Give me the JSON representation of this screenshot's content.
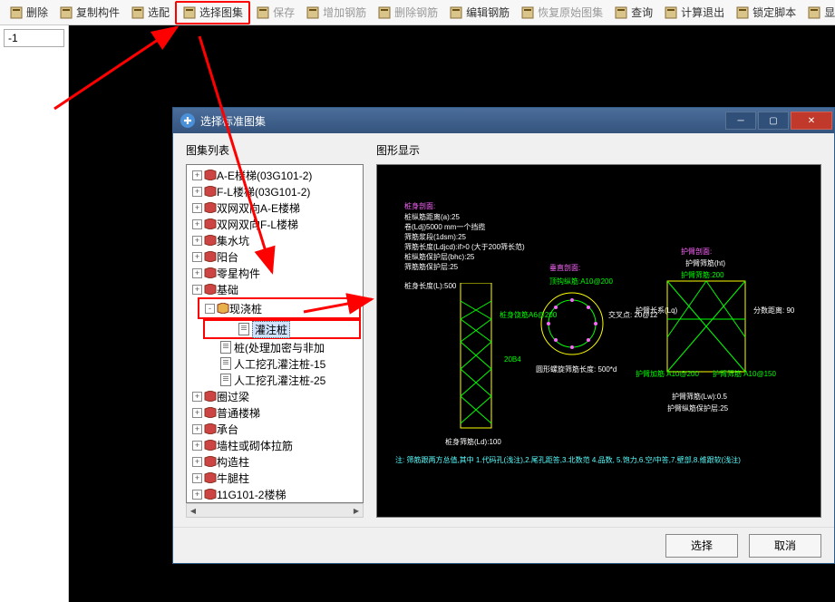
{
  "toolbar": [
    {
      "id": "delete",
      "label": "删除",
      "disabled": false
    },
    {
      "id": "copy-component",
      "label": "复制构件",
      "disabled": false
    },
    {
      "id": "select-config",
      "label": "选配",
      "disabled": false
    },
    {
      "id": "select-drawing-set",
      "label": "选择图集",
      "disabled": false,
      "highlight": true
    },
    {
      "id": "save",
      "label": "保存",
      "disabled": true
    },
    {
      "id": "add-rebar",
      "label": "增加钢筋",
      "disabled": true
    },
    {
      "id": "delete-rebar",
      "label": "删除钢筋",
      "disabled": true
    },
    {
      "id": "edit-rebar",
      "label": "编辑钢筋",
      "disabled": false
    },
    {
      "id": "restore-drawing",
      "label": "恢复原始图集",
      "disabled": true
    },
    {
      "id": "query",
      "label": "查询",
      "disabled": false
    },
    {
      "id": "calc-exit",
      "label": "计算退出",
      "disabled": false
    },
    {
      "id": "lock-script",
      "label": "锁定脚本",
      "disabled": false
    },
    {
      "id": "show-full",
      "label": "显示全图",
      "disabled": false
    }
  ],
  "left_panel": {
    "value": "-1"
  },
  "dialog": {
    "title": "选择标准图集",
    "tree_label": "图集列表",
    "preview_label": "图形显示",
    "select_btn": "选择",
    "cancel_btn": "取消",
    "tree": [
      {
        "level": 0,
        "exp": "+",
        "icon": "book",
        "label": "A-E楼梯(03G101-2)"
      },
      {
        "level": 0,
        "exp": "+",
        "icon": "book",
        "label": "F-L楼梯(03G101-2)"
      },
      {
        "level": 0,
        "exp": "+",
        "icon": "book",
        "label": "双网双向A-E楼梯"
      },
      {
        "level": 0,
        "exp": "+",
        "icon": "book",
        "label": "双网双向F-L楼梯"
      },
      {
        "level": 0,
        "exp": "+",
        "icon": "book",
        "label": "集水坑"
      },
      {
        "level": 0,
        "exp": "+",
        "icon": "book",
        "label": "阳台"
      },
      {
        "level": 0,
        "exp": "+",
        "icon": "book",
        "label": "零星构件"
      },
      {
        "level": 0,
        "exp": "+",
        "icon": "book",
        "label": "基础"
      },
      {
        "level": 0,
        "exp": "-",
        "icon": "book-open",
        "label": "现浇桩",
        "outer_hl": true
      },
      {
        "level": 1,
        "icon": "page",
        "label": "灌注桩",
        "selected": true,
        "inner_hl": true
      },
      {
        "level": 1,
        "icon": "page",
        "label": "桩(处理加密与非加"
      },
      {
        "level": 1,
        "icon": "page",
        "label": "人工挖孔灌注桩-15"
      },
      {
        "level": 1,
        "icon": "page",
        "label": "人工挖孔灌注桩-25"
      },
      {
        "level": 0,
        "exp": "+",
        "icon": "book",
        "label": "圈过梁"
      },
      {
        "level": 0,
        "exp": "+",
        "icon": "book",
        "label": "普通楼梯"
      },
      {
        "level": 0,
        "exp": "+",
        "icon": "book",
        "label": "承台"
      },
      {
        "level": 0,
        "exp": "+",
        "icon": "book",
        "label": "墙柱或砌体拉筋"
      },
      {
        "level": 0,
        "exp": "+",
        "icon": "book",
        "label": "构造柱"
      },
      {
        "level": 0,
        "exp": "+",
        "icon": "book",
        "label": "牛腿柱"
      },
      {
        "level": 0,
        "exp": "+",
        "icon": "book",
        "label": "11G101-2楼梯"
      }
    ],
    "cad": {
      "section_a": "桩身剖面:",
      "a1": "桩纵筋距离(a):25",
      "a2": "卷(Ldj)5000 mm一个挡揽",
      "a3": "筛筋浆段(1dsm):25",
      "a4": "筛筋长度(Ldjcd):if>0 (大于200筛长范)",
      "a5": "桩纵筋保护层(bhc):25",
      "a6": "筛筋筋保护层:25",
      "section_b": "垂直剖面:",
      "b1": "顶钩纵筋:A10@200",
      "b2": "交叉点: 20@12",
      "b3": "桩身饶筋:A6@200",
      "b4": "圆形螺旋筛筋长度: 500*d",
      "a7": "桩身长度(L):500",
      "a8": "桩身饶筋A6@200",
      "a9": "20B4",
      "a10": "桩身筛筋(Ld):100",
      "section_c": "护臂剖面:",
      "c1": "护臂筛筋(ht)",
      "c2": "护臂筛筋:200",
      "c3": "护臂长系(Lq)",
      "c4": "护臂加筋 A10@200",
      "c5": "分数距离: 90",
      "c6": "护臂筛筋 A10@150",
      "c7": "护臂筛筋(Lw):0.5",
      "c8": "护臂纵筋保护层:25",
      "note": "注: 筛筋跟两方总值,其中 1.代码孔(浅注),2.尾孔距答,3.北数范 4.品数, 5.饱力,6.空/中答,7.壁部,8.维跟软(浅注)"
    }
  }
}
